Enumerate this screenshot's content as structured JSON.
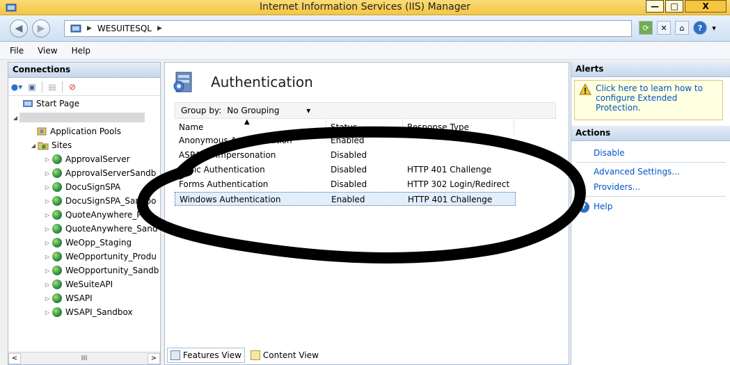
{
  "window": {
    "title": "Internet Information Services (IIS) Manager",
    "minimize_glyph": "—",
    "maximize_glyph": "□",
    "close_glyph": "X"
  },
  "address": {
    "server": "WESUITESQL",
    "separator": "▶"
  },
  "menu": [
    "File",
    "View",
    "Help"
  ],
  "connections": {
    "title": "Connections",
    "start_page": "Start Page",
    "app_pools": "Application Pools",
    "sites_label": "Sites",
    "sites": [
      "ApprovalServer",
      "ApprovalServerSandb",
      "DocuSignSPA",
      "DocuSignSPA_Sandbo",
      "QuoteAnywhere_P",
      "QuoteAnywhere_Sand",
      "WeOpp_Staging",
      "WeOpportunity_Produ",
      "WeOpportunity_Sandb",
      "WeSuiteAPI",
      "WSAPI",
      "WSAPI_Sandbox"
    ],
    "scroll_thumb": "III"
  },
  "feature": {
    "title": "Authentication",
    "group_by_label": "Group by:",
    "group_by_value": "No Grouping",
    "columns": [
      "Name",
      "Status",
      "Response Type"
    ],
    "rows": [
      {
        "name": "Anonymous Authentication",
        "status": "Enabled",
        "response": ""
      },
      {
        "name": "ASP.NET Impersonation",
        "status": "Disabled",
        "response": ""
      },
      {
        "name": "Basic Authentication",
        "status": "Disabled",
        "response": "HTTP 401 Challenge"
      },
      {
        "name": "Forms Authentication",
        "status": "Disabled",
        "response": "HTTP 302 Login/Redirect"
      },
      {
        "name": "Windows Authentication",
        "status": "Enabled",
        "response": "HTTP 401 Challenge"
      }
    ],
    "features_view": "Features View",
    "content_view": "Content View"
  },
  "alerts": {
    "title": "Alerts",
    "message": "Click here to learn how to configure Extended Protection."
  },
  "actions": {
    "title": "Actions",
    "disable": "Disable",
    "advanced_settings": "Advanced Settings...",
    "providers": "Providers...",
    "help": "Help"
  },
  "colors": {
    "accent_link": "#0054c6",
    "titlebar": "#f4c542",
    "annotation_stroke": "#000000"
  }
}
